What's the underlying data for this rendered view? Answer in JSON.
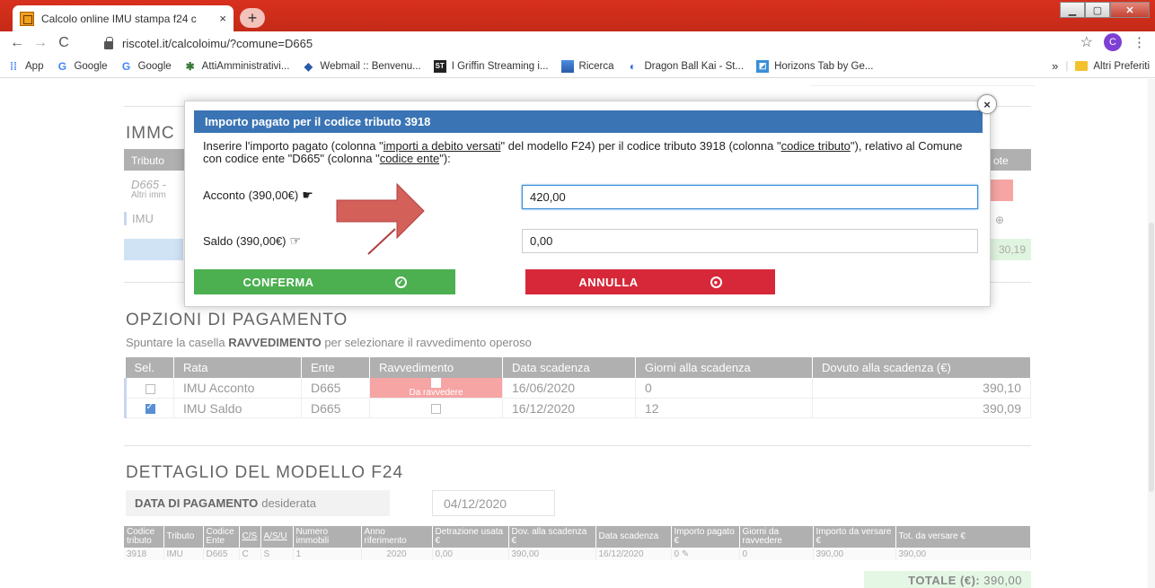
{
  "browser": {
    "tab_title": "Calcolo online IMU stampa f24 c",
    "tab_close": "×",
    "new_tab": "+",
    "url": "riscotel.it/calcoloimu/?comune=D665",
    "profile_initial": "C",
    "bookmarks": [
      {
        "label": "App",
        "icon": "apps-grid-icon"
      },
      {
        "label": "Google",
        "icon": "google-g-icon"
      },
      {
        "label": "Google",
        "icon": "google-g-icon"
      },
      {
        "label": "AttiAmministrativi...",
        "icon": "atti-icon"
      },
      {
        "label": "Webmail :: Benvenu...",
        "icon": "webmail-icon"
      },
      {
        "label": "I Griffin Streaming i...",
        "icon": "st-icon"
      },
      {
        "label": "Ricerca",
        "icon": "ricerca-icon"
      },
      {
        "label": "Dragon Ball Kai - St...",
        "icon": "dragonball-icon"
      },
      {
        "label": "Horizons Tab by Ge...",
        "icon": "horizons-icon"
      }
    ],
    "more_bookmarks": "»",
    "other_favorites": "Altri Preferiti"
  },
  "background": {
    "immo_title": "IMMC",
    "tributo_header": "Tributo",
    "d665_frag": "D665 -",
    "altri_frag": "Altri imm",
    "imu_frag": "IMU",
    "te_frag": "ote",
    "green_right": "30,19"
  },
  "modal": {
    "title": "Importo pagato per il codice tributo 3918",
    "close": "×",
    "desc_parts": {
      "p1": "Inserire l'importo pagato (colonna \"",
      "link1": "importi a debito versati",
      "p2": "\" del modello F24) per il codice tributo 3918 (colonna \"",
      "link2": "codice tributo",
      "p3": "\"), relativo al Comune con codice ente \"D665\" (colonna \"",
      "link3": "codice ente",
      "p4": "\"):"
    },
    "acconto_label": "Acconto (390,00€)",
    "acconto_value": "420,00",
    "saldo_label": "Saldo (390,00€)",
    "saldo_value": "0,00",
    "confirm_label": "CONFERMA",
    "cancel_label": "ANNULLA"
  },
  "opzioni": {
    "title": "OPZIONI DI PAGAMENTO",
    "hint_pre": "Spuntare la casella ",
    "hint_bold": "RAVVEDIMENTO",
    "hint_post": " per selezionare il ravvedimento operoso",
    "headers": [
      "Sel.",
      "Rata",
      "Ente",
      "Ravvedimento",
      "Data scadenza",
      "Giorni alla scadenza",
      "Dovuto alla scadenza (€)"
    ],
    "rows": [
      {
        "rata": "IMU Acconto",
        "ente": "D665",
        "ravv": "Da ravvedere",
        "data": "16/06/2020",
        "giorni": "0",
        "dovuto": "390,10",
        "selected": false
      },
      {
        "rata": "IMU Saldo",
        "ente": "D665",
        "ravv": "",
        "data": "16/12/2020",
        "giorni": "12",
        "dovuto": "390,09",
        "selected": true
      }
    ]
  },
  "dettaglio": {
    "title": "DETTAGLIO DEL MODELLO F24",
    "date_label_bold": "DATA DI PAGAMENTO",
    "date_label_rest": "desiderata",
    "date_value": "04/12/2020",
    "headers": [
      "Codice tributo",
      "Tributo",
      "Codice Ente",
      "C/S",
      "A/S/U",
      "Numero immobili",
      "Anno riferimento",
      "Detrazione usata €",
      "Dov. alla scadenza €",
      "Data scadenza",
      "Importo pagato €",
      "Giorni da ravvedere",
      "Importo da versare €",
      "Tot. da versare €"
    ],
    "row": [
      "3918",
      "IMU",
      "D665",
      "C",
      "S",
      "1",
      "2020",
      "0,00",
      "390,00",
      "16/12/2020",
      "0",
      "0",
      "390,00",
      "390,00"
    ],
    "totale_label": "TOTALE (€):",
    "totale_value": "390,00"
  }
}
